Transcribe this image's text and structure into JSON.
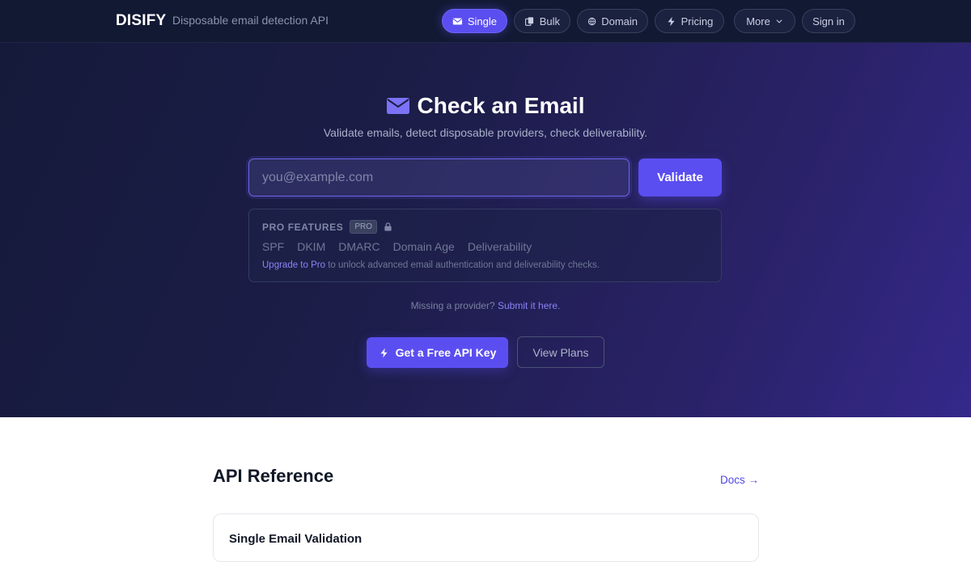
{
  "nav": {
    "brand": "DISIFY",
    "tagline": "Disposable email detection API",
    "items": [
      {
        "label": "Single",
        "icon": "envelope-icon",
        "active": true
      },
      {
        "label": "Bulk",
        "icon": "copy-icon",
        "active": false
      },
      {
        "label": "Domain",
        "icon": "globe-icon",
        "active": false
      },
      {
        "label": "Pricing",
        "icon": "bolt-icon",
        "active": false
      },
      {
        "label": "More",
        "icon": "chevron-down-icon",
        "active": false
      },
      {
        "label": "Sign in",
        "active": false
      }
    ]
  },
  "hero": {
    "title": "Check an Email",
    "subtitle": "Validate emails, detect disposable providers, check deliverability.",
    "email_placeholder": "you@example.com",
    "email_value": "",
    "validate_label": "Validate"
  },
  "pro": {
    "label": "PRO FEATURES",
    "badge": "PRO",
    "features": [
      "SPF",
      "DKIM",
      "DMARC",
      "Domain Age",
      "Deliverability"
    ],
    "upgrade_link": "Upgrade to Pro",
    "upgrade_text": " to unlock advanced email authentication and deliverability checks."
  },
  "missing": {
    "text": "Missing a provider? ",
    "link": "Submit it here",
    "suffix": "."
  },
  "cta": {
    "api_key_label": "Get a Free API Key",
    "plans_label": "View Plans"
  },
  "api_reference": {
    "title": "API Reference",
    "docs_link": "Docs →",
    "card_title": "Single Email Validation"
  },
  "colors": {
    "accent": "#5b4ef0",
    "nav_bg": "#121933",
    "link": "#8b83f5"
  }
}
